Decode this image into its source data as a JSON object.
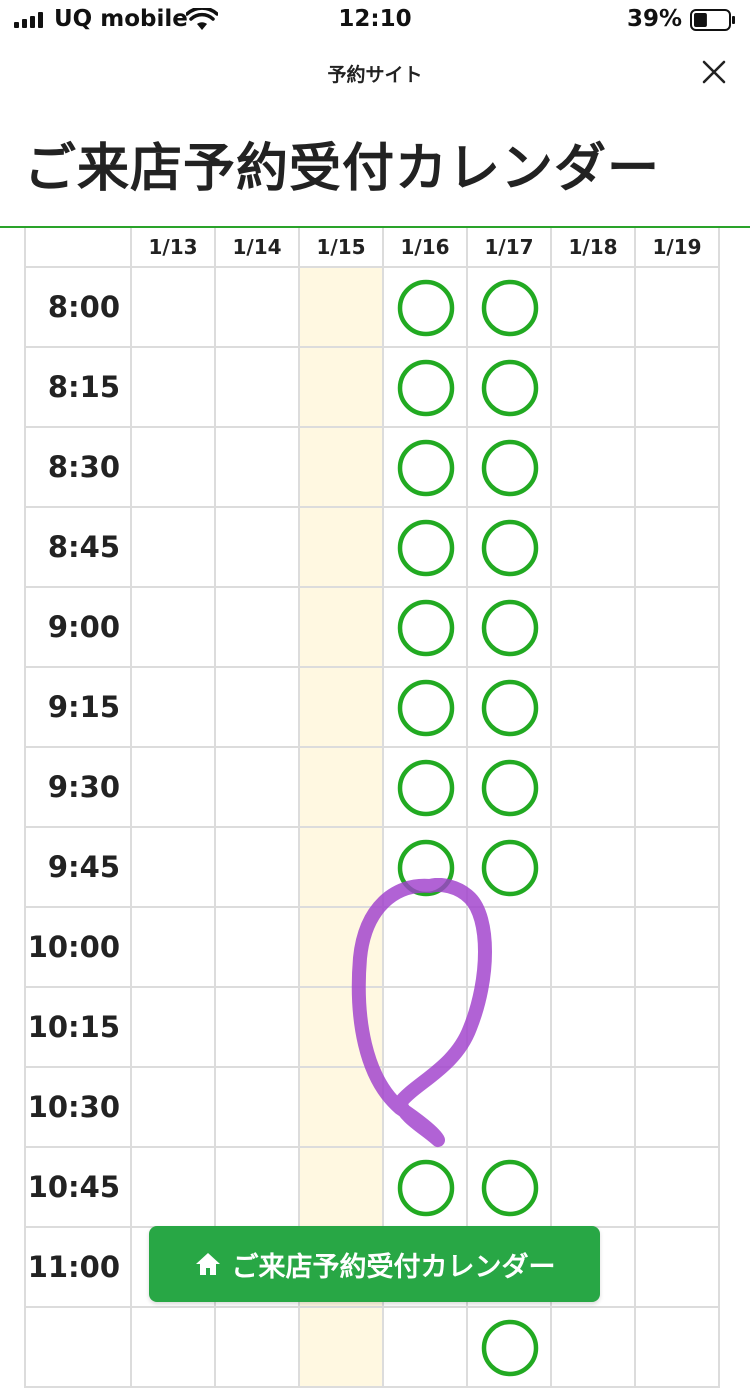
{
  "status_bar": {
    "carrier": "UQ mobile",
    "time": "12:10",
    "battery_percent": "39%",
    "battery_level": 0.39
  },
  "nav": {
    "title": "予約サイト",
    "close_icon": "close-icon"
  },
  "page": {
    "title": "ご来店予約受付カレンダー"
  },
  "calendar": {
    "dates": [
      "1/13",
      "1/14",
      "1/15",
      "1/16",
      "1/17",
      "1/18",
      "1/19"
    ],
    "highlighted_date": "1/15",
    "available_color": "#22aa22",
    "holiday_color": "#fff8e1",
    "rows": [
      {
        "time": "8:00",
        "available": [
          false,
          false,
          false,
          true,
          true,
          false,
          false
        ]
      },
      {
        "time": "8:15",
        "available": [
          false,
          false,
          false,
          true,
          true,
          false,
          false
        ]
      },
      {
        "time": "8:30",
        "available": [
          false,
          false,
          false,
          true,
          true,
          false,
          false
        ]
      },
      {
        "time": "8:45",
        "available": [
          false,
          false,
          false,
          true,
          true,
          false,
          false
        ]
      },
      {
        "time": "9:00",
        "available": [
          false,
          false,
          false,
          true,
          true,
          false,
          false
        ]
      },
      {
        "time": "9:15",
        "available": [
          false,
          false,
          false,
          true,
          true,
          false,
          false
        ]
      },
      {
        "time": "9:30",
        "available": [
          false,
          false,
          false,
          true,
          true,
          false,
          false
        ]
      },
      {
        "time": "9:45",
        "available": [
          false,
          false,
          false,
          true,
          true,
          false,
          false
        ]
      },
      {
        "time": "10:00",
        "available": [
          false,
          false,
          false,
          false,
          false,
          false,
          false
        ]
      },
      {
        "time": "10:15",
        "available": [
          false,
          false,
          false,
          false,
          false,
          false,
          false
        ]
      },
      {
        "time": "10:30",
        "available": [
          false,
          false,
          false,
          false,
          false,
          false,
          false
        ]
      },
      {
        "time": "10:45",
        "available": [
          false,
          false,
          false,
          true,
          true,
          false,
          false
        ]
      },
      {
        "time": "11:00",
        "available": [
          false,
          false,
          false,
          false,
          false,
          false,
          false
        ]
      },
      {
        "time": "",
        "available": [
          false,
          false,
          false,
          false,
          true,
          false,
          false
        ]
      }
    ]
  },
  "overlay": {
    "annotation_color": "#a040cc"
  },
  "bottom_button": {
    "icon": "home-icon",
    "label": "ご来店予約受付カレンダー"
  }
}
